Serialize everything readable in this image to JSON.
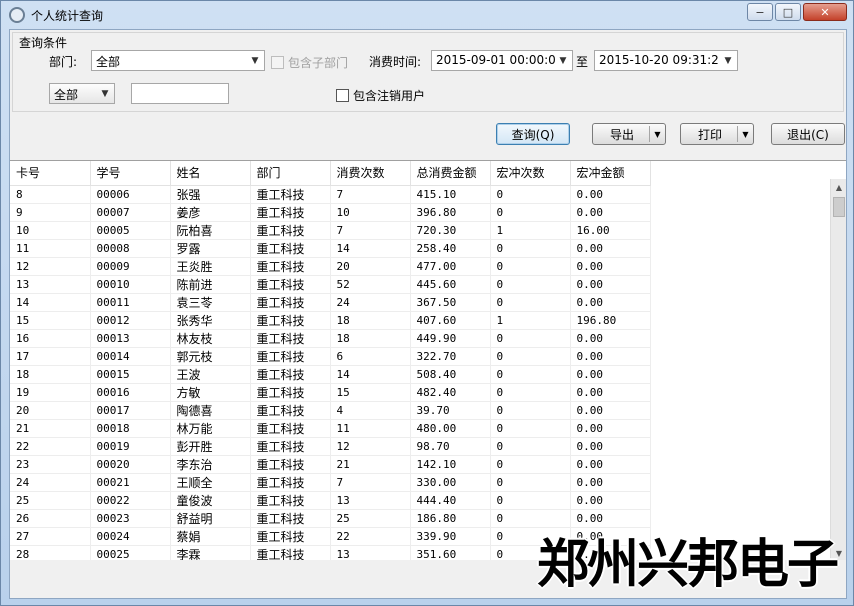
{
  "window": {
    "title": "个人统计查询",
    "min_glyph": "−",
    "max_glyph": "□",
    "close_glyph": "✕"
  },
  "query": {
    "group_label": "查询条件",
    "dept_label": "部门:",
    "dept_value": "全部",
    "include_sub_label": "包含子部门",
    "time_label": "消费时间:",
    "time_from": "2015-09-01 00:00:0",
    "to_label": "至",
    "time_to": "2015-10-20 09:31:2",
    "filter_value": "全部",
    "text_value": "",
    "include_cancel_label": "包含注销用户"
  },
  "buttons": {
    "query": "查询(Q)",
    "export": "导出",
    "print": "打印",
    "exit": "退出(C)"
  },
  "table": {
    "headers": [
      "卡号",
      "学号",
      "姓名",
      "部门",
      "消费次数",
      "总消费金额",
      "宏冲次数",
      "宏冲金额"
    ],
    "rows": [
      [
        "8",
        "00006",
        "张强",
        "重工科技",
        "7",
        "415.10",
        "0",
        "0.00"
      ],
      [
        "9",
        "00007",
        "姜彦",
        "重工科技",
        "10",
        "396.80",
        "0",
        "0.00"
      ],
      [
        "10",
        "00005",
        "阮柏喜",
        "重工科技",
        "7",
        "720.30",
        "1",
        "16.00"
      ],
      [
        "11",
        "00008",
        "罗露",
        "重工科技",
        "14",
        "258.40",
        "0",
        "0.00"
      ],
      [
        "12",
        "00009",
        "王炎胜",
        "重工科技",
        "20",
        "477.00",
        "0",
        "0.00"
      ],
      [
        "13",
        "00010",
        "陈前进",
        "重工科技",
        "52",
        "445.60",
        "0",
        "0.00"
      ],
      [
        "14",
        "00011",
        "袁三苓",
        "重工科技",
        "24",
        "367.50",
        "0",
        "0.00"
      ],
      [
        "15",
        "00012",
        "张秀华",
        "重工科技",
        "18",
        "407.60",
        "1",
        "196.80"
      ],
      [
        "16",
        "00013",
        "林友枝",
        "重工科技",
        "18",
        "449.90",
        "0",
        "0.00"
      ],
      [
        "17",
        "00014",
        "郭元枝",
        "重工科技",
        "6",
        "322.70",
        "0",
        "0.00"
      ],
      [
        "18",
        "00015",
        "王波",
        "重工科技",
        "14",
        "508.40",
        "0",
        "0.00"
      ],
      [
        "19",
        "00016",
        "方敏",
        "重工科技",
        "15",
        "482.40",
        "0",
        "0.00"
      ],
      [
        "20",
        "00017",
        "陶德喜",
        "重工科技",
        "4",
        "39.70",
        "0",
        "0.00"
      ],
      [
        "21",
        "00018",
        "林万能",
        "重工科技",
        "11",
        "480.00",
        "0",
        "0.00"
      ],
      [
        "22",
        "00019",
        "彭开胜",
        "重工科技",
        "12",
        "98.70",
        "0",
        "0.00"
      ],
      [
        "23",
        "00020",
        "李东治",
        "重工科技",
        "21",
        "142.10",
        "0",
        "0.00"
      ],
      [
        "24",
        "00021",
        "王顺全",
        "重工科技",
        "7",
        "330.00",
        "0",
        "0.00"
      ],
      [
        "25",
        "00022",
        "童俊波",
        "重工科技",
        "13",
        "444.40",
        "0",
        "0.00"
      ],
      [
        "26",
        "00023",
        "舒益明",
        "重工科技",
        "25",
        "186.80",
        "0",
        "0.00"
      ],
      [
        "27",
        "00024",
        "蔡娟",
        "重工科技",
        "22",
        "339.90",
        "0",
        "0.00"
      ],
      [
        "28",
        "00025",
        "李霖",
        "重工科技",
        "13",
        "351.60",
        "0",
        "0.00"
      ]
    ]
  },
  "watermark": "郑州兴邦电子",
  "colors": {
    "titlebar": "#c3d7ee",
    "close_button": "#c4412a",
    "grid_bg": "#ffffff"
  }
}
